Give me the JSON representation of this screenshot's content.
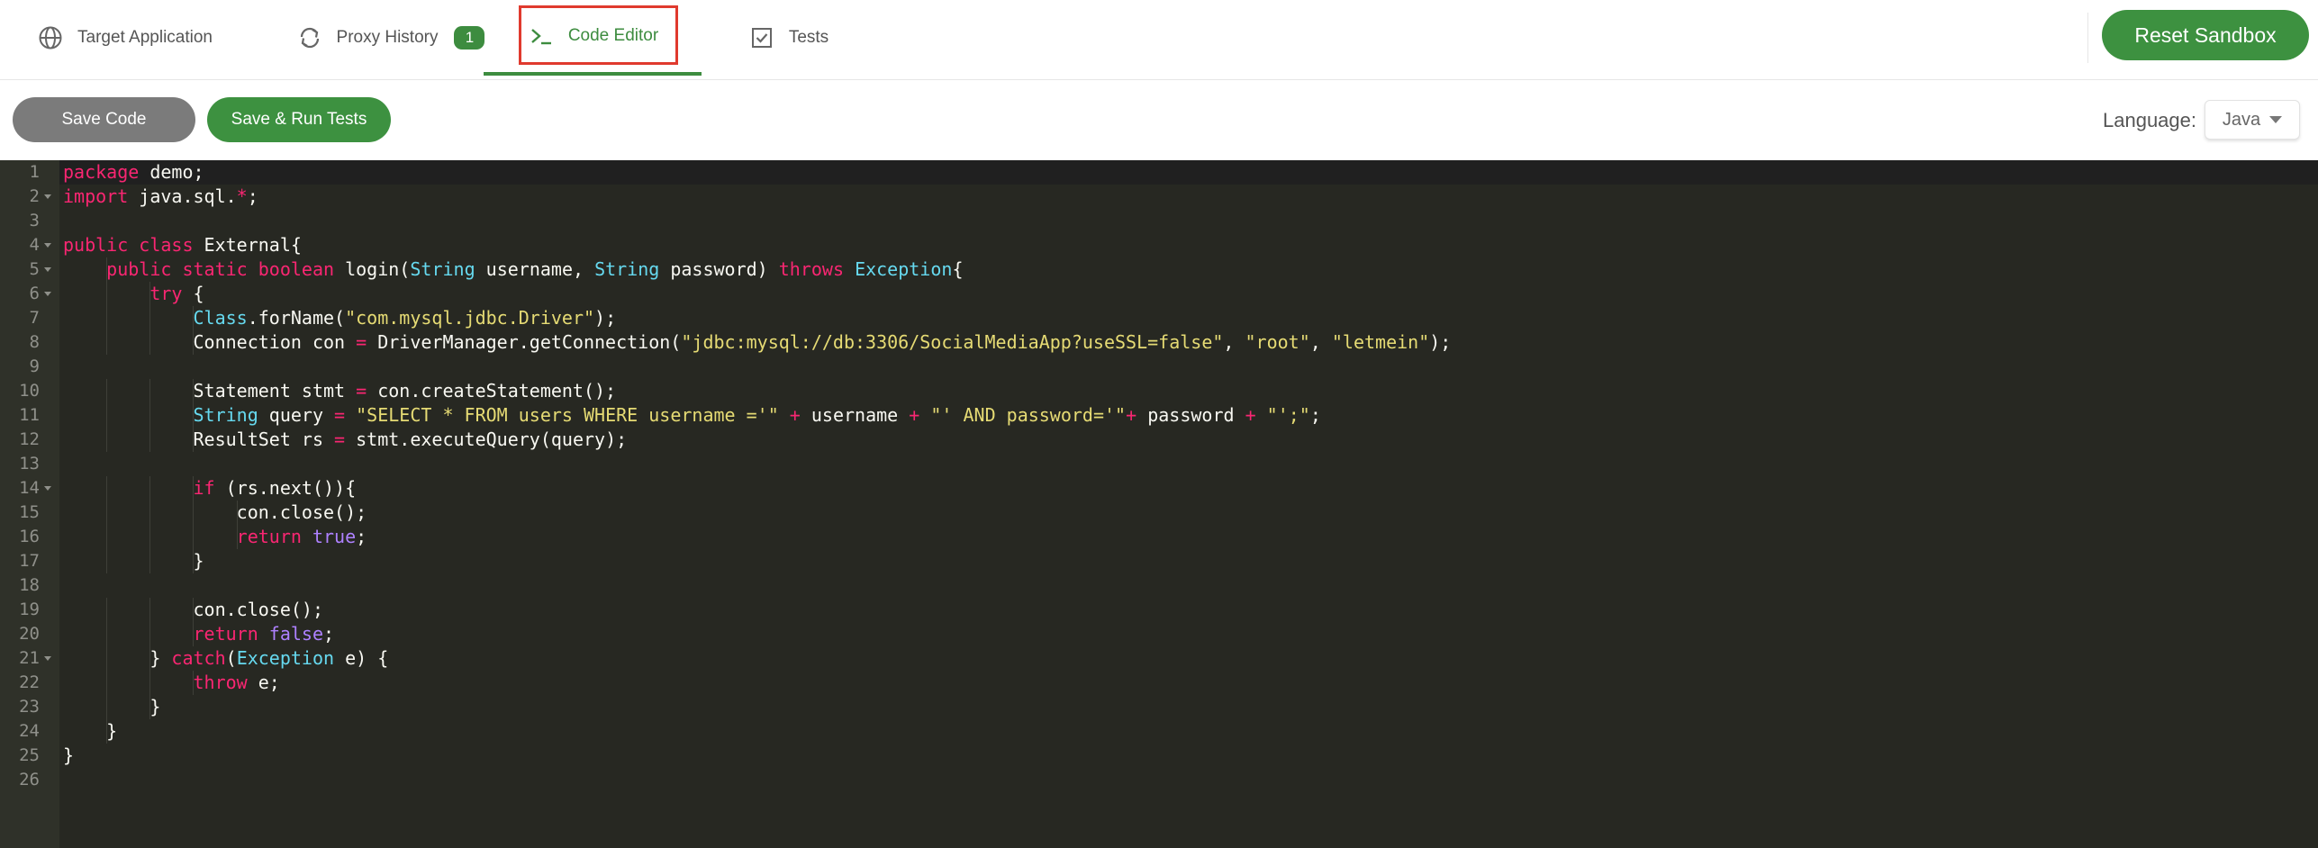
{
  "nav": {
    "tabs": [
      {
        "label": "Target Application",
        "icon": "globe-icon"
      },
      {
        "label": "Proxy History",
        "icon": "refresh-icon",
        "badge": "1"
      },
      {
        "label": "Code Editor",
        "icon": "terminal-icon",
        "active": true
      },
      {
        "label": "Tests",
        "icon": "checkbox-icon"
      }
    ],
    "reset_label": "Reset Sandbox"
  },
  "toolbar": {
    "save_label": "Save Code",
    "run_label": "Save & Run Tests",
    "language_label": "Language:",
    "language_value": "Java"
  },
  "colors": {
    "accent": "#3d9140",
    "highlight_outline": "#e03a2e",
    "editor_bg": "#272822",
    "keyword": "#f92672",
    "type": "#66d9ef",
    "string": "#e6db74",
    "constant": "#ae81ff"
  },
  "editor": {
    "lines": [
      [
        [
          "k",
          "package"
        ],
        [
          "p",
          " demo;"
        ]
      ],
      [
        [
          "k",
          "import"
        ],
        [
          "p",
          " java.sql."
        ],
        [
          "k",
          "*"
        ],
        [
          "p",
          ";"
        ]
      ],
      [],
      [
        [
          "k",
          "public"
        ],
        [
          "p",
          " "
        ],
        [
          "k",
          "class"
        ],
        [
          "p",
          " External{"
        ]
      ],
      [
        [
          "p",
          "    "
        ],
        [
          "k",
          "public"
        ],
        [
          "p",
          " "
        ],
        [
          "k",
          "static"
        ],
        [
          "p",
          " "
        ],
        [
          "k",
          "boolean"
        ],
        [
          "p",
          " login("
        ],
        [
          "t",
          "String"
        ],
        [
          "p",
          " username, "
        ],
        [
          "t",
          "String"
        ],
        [
          "p",
          " password) "
        ],
        [
          "k",
          "throws"
        ],
        [
          "p",
          " "
        ],
        [
          "t",
          "Exception"
        ],
        [
          "p",
          "{"
        ]
      ],
      [
        [
          "p",
          "        "
        ],
        [
          "k",
          "try"
        ],
        [
          "p",
          " {"
        ]
      ],
      [
        [
          "p",
          "            "
        ],
        [
          "t",
          "Class"
        ],
        [
          "p",
          ".forName("
        ],
        [
          "s",
          "\"com.mysql.jdbc.Driver\""
        ],
        [
          "p",
          ");"
        ]
      ],
      [
        [
          "p",
          "            Connection con "
        ],
        [
          "k",
          "="
        ],
        [
          "p",
          " DriverManager.getConnection("
        ],
        [
          "s",
          "\"jdbc:mysql://db:3306/SocialMediaApp?useSSL=false\""
        ],
        [
          "p",
          ", "
        ],
        [
          "s",
          "\"root\""
        ],
        [
          "p",
          ", "
        ],
        [
          "s",
          "\"letmein\""
        ],
        [
          "p",
          ");"
        ]
      ],
      [],
      [
        [
          "p",
          "            Statement stmt "
        ],
        [
          "k",
          "="
        ],
        [
          "p",
          " con.createStatement();"
        ]
      ],
      [
        [
          "p",
          "            "
        ],
        [
          "t",
          "String"
        ],
        [
          "p",
          " query "
        ],
        [
          "k",
          "="
        ],
        [
          "p",
          " "
        ],
        [
          "s",
          "\"SELECT * FROM users WHERE username ='\""
        ],
        [
          "p",
          " "
        ],
        [
          "k",
          "+"
        ],
        [
          "p",
          " username "
        ],
        [
          "k",
          "+"
        ],
        [
          "p",
          " "
        ],
        [
          "s",
          "\"' AND password='\""
        ],
        [
          "k",
          "+"
        ],
        [
          "p",
          " password "
        ],
        [
          "k",
          "+"
        ],
        [
          "p",
          " "
        ],
        [
          "s",
          "\"';\""
        ],
        [
          "p",
          ";"
        ]
      ],
      [
        [
          "p",
          "            ResultSet rs "
        ],
        [
          "k",
          "="
        ],
        [
          "p",
          " stmt.executeQuery(query);"
        ]
      ],
      [],
      [
        [
          "p",
          "            "
        ],
        [
          "k",
          "if"
        ],
        [
          "p",
          " (rs.next()){"
        ]
      ],
      [
        [
          "p",
          "                con.close();"
        ]
      ],
      [
        [
          "p",
          "                "
        ],
        [
          "k",
          "return"
        ],
        [
          "p",
          " "
        ],
        [
          "c",
          "true"
        ],
        [
          "p",
          ";"
        ]
      ],
      [
        [
          "p",
          "            }"
        ]
      ],
      [],
      [
        [
          "p",
          "            con.close();"
        ]
      ],
      [
        [
          "p",
          "            "
        ],
        [
          "k",
          "return"
        ],
        [
          "p",
          " "
        ],
        [
          "c",
          "false"
        ],
        [
          "p",
          ";"
        ]
      ],
      [
        [
          "p",
          "        } "
        ],
        [
          "k",
          "catch"
        ],
        [
          "p",
          "("
        ],
        [
          "t",
          "Exception"
        ],
        [
          "p",
          " e) {"
        ]
      ],
      [
        [
          "p",
          "            "
        ],
        [
          "k",
          "throw"
        ],
        [
          "p",
          " e;"
        ]
      ],
      [
        [
          "p",
          "        }"
        ]
      ],
      [
        [
          "p",
          "    }"
        ]
      ],
      [
        [
          "p",
          "}"
        ]
      ],
      []
    ]
  }
}
